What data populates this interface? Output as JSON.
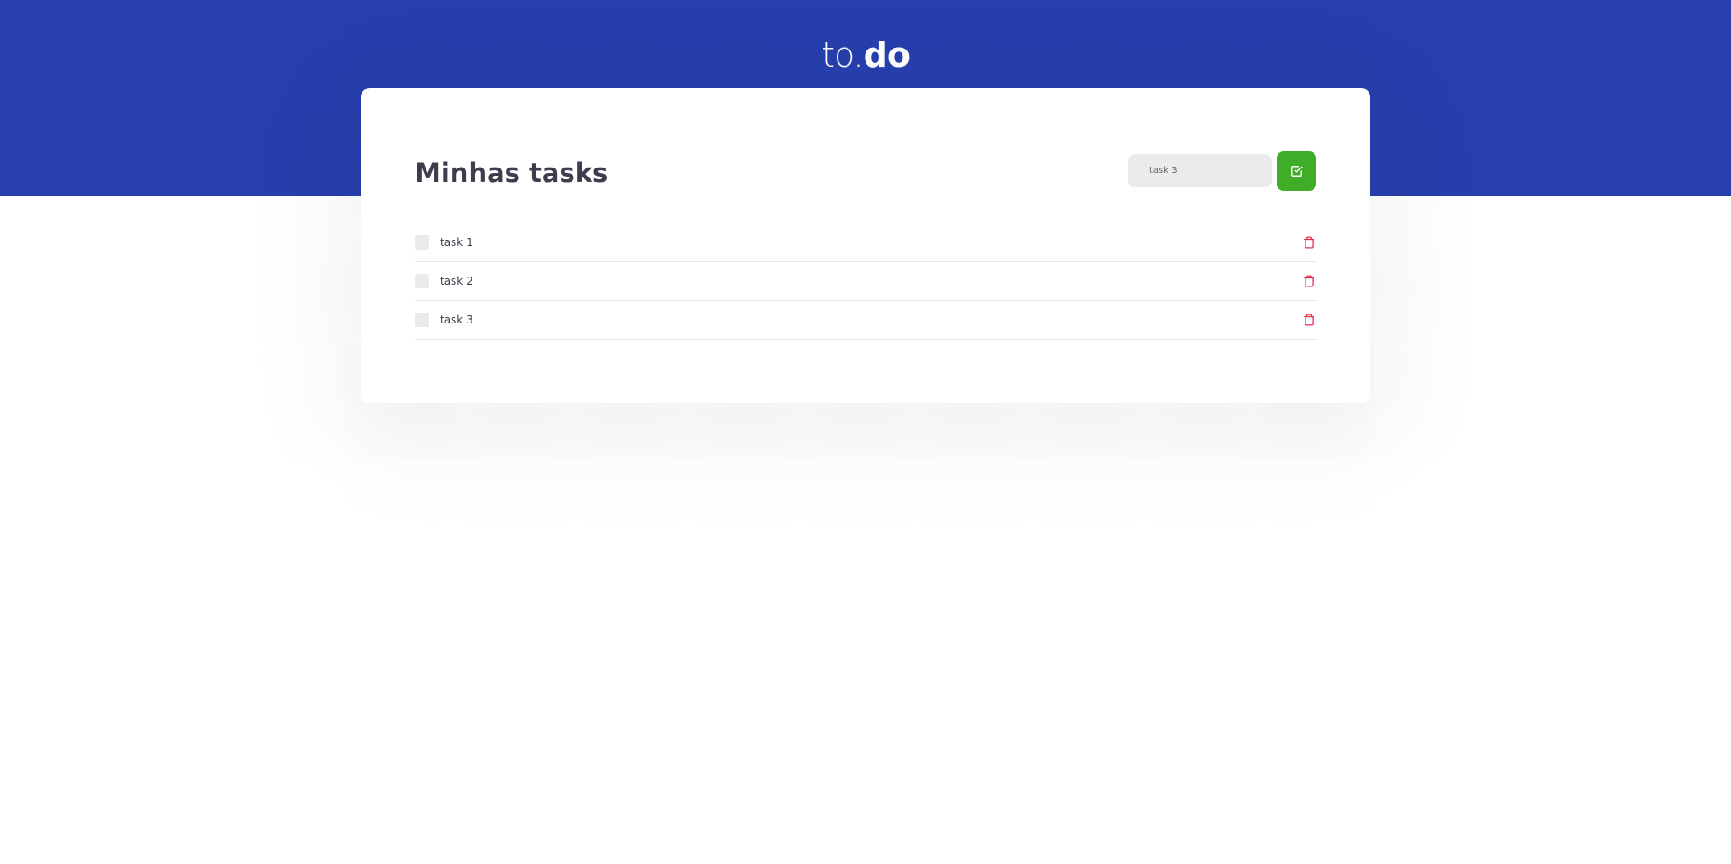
{
  "header": {
    "logo_prefix": "to.",
    "logo_suffix": "do",
    "background_color": "#273fad"
  },
  "main": {
    "title": "Minhas tasks",
    "new_task_input": {
      "value": "task 3"
    },
    "add_button": {
      "icon": "check-square-icon",
      "color": "#3fad27"
    },
    "tasks": [
      {
        "label": "task 1",
        "completed": false,
        "delete_icon": "trash-icon"
      },
      {
        "label": "task 2",
        "completed": false,
        "delete_icon": "trash-icon"
      },
      {
        "label": "task 3",
        "completed": false,
        "delete_icon": "trash-icon"
      }
    ],
    "delete_color": "#e52e4d"
  }
}
